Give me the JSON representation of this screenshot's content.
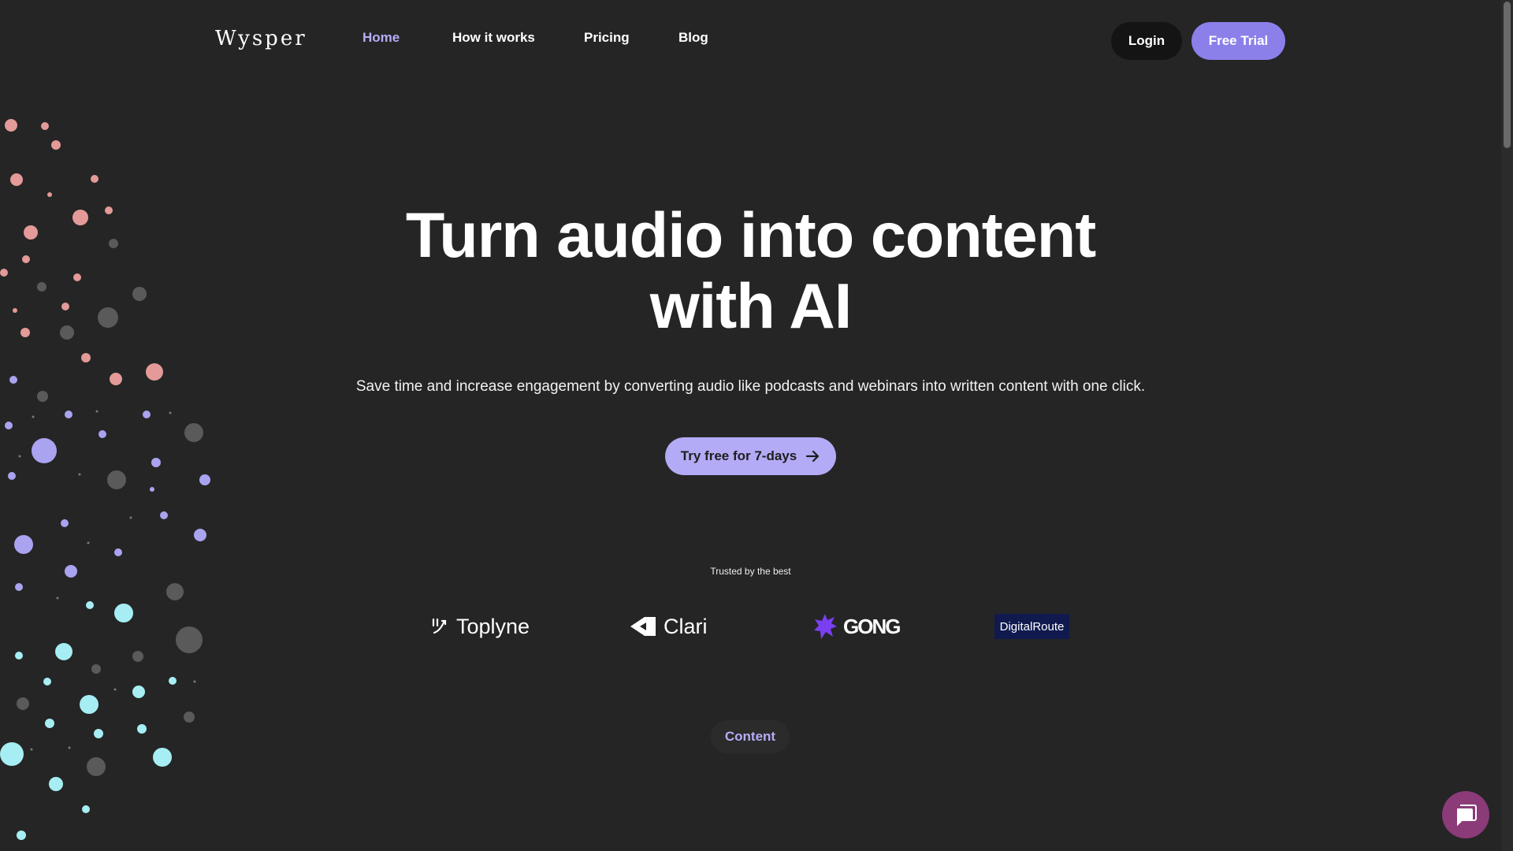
{
  "header": {
    "logo": "Wysper",
    "nav": [
      {
        "label": "Home",
        "active": true
      },
      {
        "label": "How it works",
        "active": false
      },
      {
        "label": "Pricing",
        "active": false
      },
      {
        "label": "Blog",
        "active": false
      }
    ],
    "login_label": "Login",
    "trial_label": "Free Trial"
  },
  "hero": {
    "title_line1": "Turn audio into content",
    "title_line2": "with AI",
    "subtitle": "Save time and increase engagement by converting audio like podcasts and webinars into written content with one click.",
    "cta_label": "Try free for 7-days"
  },
  "trusted": {
    "heading": "Trusted by the best",
    "logos": [
      "Toplyne",
      "Clari",
      "GONG",
      "DigitalRoute"
    ]
  },
  "content_pill": "Content",
  "colors": {
    "background": "#252525",
    "accent": "#8b80ea",
    "accent_light": "#b3abf5",
    "chat_button": "#8a3b78"
  },
  "icons": {
    "cta": "arrow-right-icon",
    "chat": "chat-bubble-icon"
  }
}
